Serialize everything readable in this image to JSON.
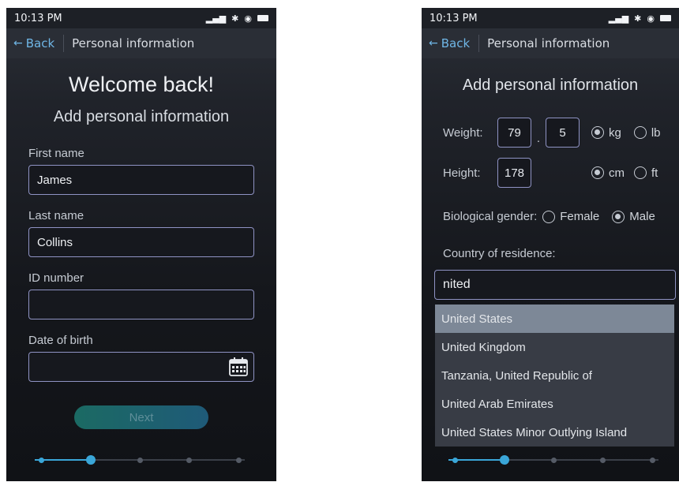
{
  "status": {
    "time": "10:13 PM"
  },
  "nav": {
    "back_label": "Back",
    "title": "Personal information"
  },
  "left": {
    "welcome": "Welcome back!",
    "subtitle": "Add personal information",
    "fields": {
      "first_name_label": "First name",
      "first_name_value": "James",
      "last_name_label": "Last name",
      "last_name_value": "Collins",
      "id_label": "ID number",
      "id_value": "",
      "dob_label": "Date of birth",
      "dob_value": ""
    },
    "next_label": "Next",
    "progress": {
      "steps": 5,
      "current": 2
    }
  },
  "right": {
    "title": "Add personal information",
    "weight_label": "Weight:",
    "weight_whole": "79",
    "weight_separator": ".",
    "weight_decimal": "5",
    "unit_kg": "kg",
    "unit_lb": "lb",
    "height_label": "Height:",
    "height_value": "178",
    "unit_cm": "cm",
    "unit_ft": "ft",
    "gender_label": "Biological gender:",
    "gender_female": "Female",
    "gender_male": "Male",
    "country_label": "Country of residence:",
    "country_query": "nited",
    "country_options": [
      "United States",
      "United Kingdom",
      "Tanzania, United Republic of",
      "United Arab Emirates",
      "United States Minor Outlying Island"
    ],
    "progress": {
      "steps": 5,
      "current": 2
    }
  },
  "icons": [
    "back-arrow-icon",
    "signal-icon",
    "bluetooth-icon",
    "wifi-icon",
    "battery-icon",
    "calendar-icon"
  ],
  "colors": {
    "accent": "#6fb6e6",
    "field_border": "#8f93c4",
    "progress_active": "#3aa6d8"
  }
}
